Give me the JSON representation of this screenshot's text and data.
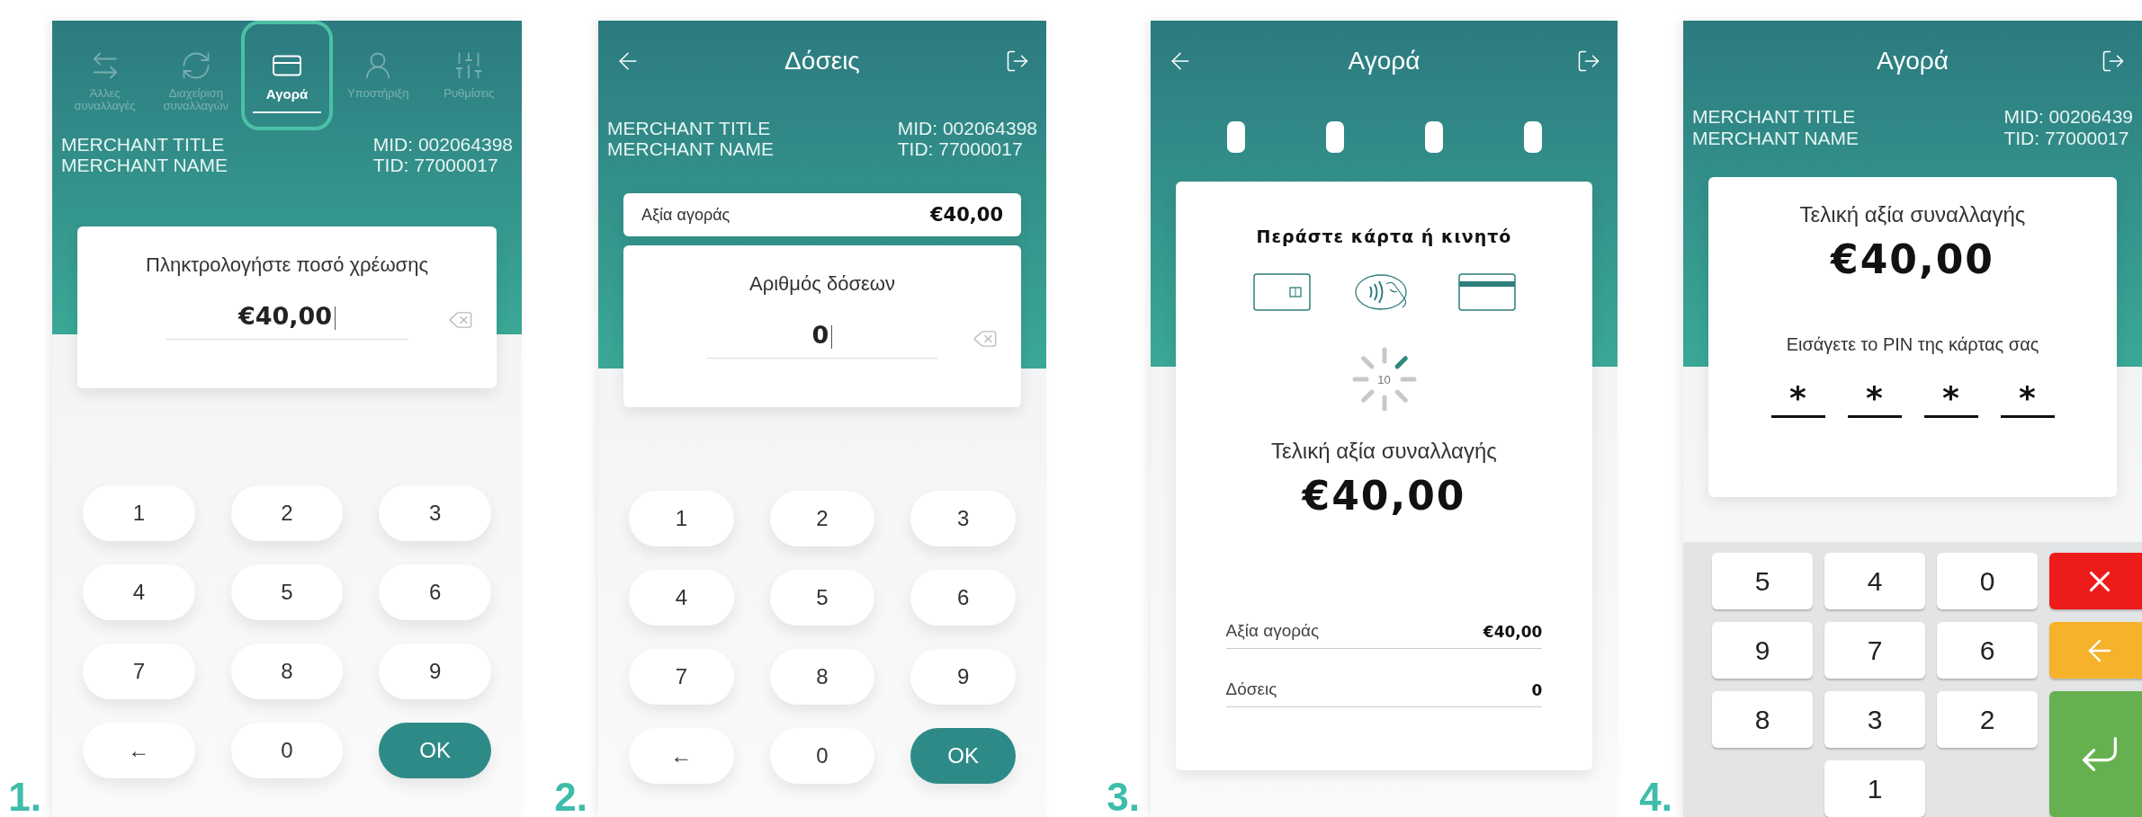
{
  "screens": [
    {
      "kind": "amount_entry",
      "step": "1.",
      "tabs": [
        {
          "label": "Άλλες συναλλαγές",
          "selected": false
        },
        {
          "label": "Διαχείριση συναλλαγών",
          "selected": false
        },
        {
          "label": "Αγορά",
          "selected": true
        },
        {
          "label": "Υποστήριξη",
          "selected": false
        },
        {
          "label": "Ρυθμίσεις",
          "selected": false
        }
      ],
      "merchant": {
        "title": "MERCHANT TITLE",
        "name": "MERCHANT NAME",
        "mid": "MID: 002064398",
        "tid": "TID: 77000017"
      },
      "prompt": "Πληκτρολογήστε ποσό χρέωσης",
      "value": "€40,00",
      "keypad": [
        {
          "label": "1",
          "kind": "digit"
        },
        {
          "label": "2",
          "kind": "digit"
        },
        {
          "label": "3",
          "kind": "digit"
        },
        {
          "label": "4",
          "kind": "digit"
        },
        {
          "label": "5",
          "kind": "digit"
        },
        {
          "label": "6",
          "kind": "digit"
        },
        {
          "label": "7",
          "kind": "digit"
        },
        {
          "label": "8",
          "kind": "digit"
        },
        {
          "label": "9",
          "kind": "digit"
        },
        {
          "label": "←",
          "kind": "back"
        },
        {
          "label": "0",
          "kind": "digit"
        },
        {
          "label": "OK",
          "kind": "ok"
        }
      ]
    },
    {
      "kind": "installments",
      "step": "2.",
      "title": "Δόσεις",
      "back_button": true,
      "merchant": {
        "title": "MERCHANT TITLE",
        "name": "MERCHANT NAME",
        "mid": "MID: 002064398",
        "tid": "TID: 77000017"
      },
      "summary": {
        "label": "Αξία αγοράς",
        "value": "€40,00"
      },
      "prompt": "Αριθμός δόσεων",
      "value": "0",
      "keypad": [
        {
          "label": "1",
          "kind": "digit"
        },
        {
          "label": "2",
          "kind": "digit"
        },
        {
          "label": "3",
          "kind": "digit"
        },
        {
          "label": "4",
          "kind": "digit"
        },
        {
          "label": "5",
          "kind": "digit"
        },
        {
          "label": "6",
          "kind": "digit"
        },
        {
          "label": "7",
          "kind": "digit"
        },
        {
          "label": "8",
          "kind": "digit"
        },
        {
          "label": "9",
          "kind": "digit"
        },
        {
          "label": "←",
          "kind": "back"
        },
        {
          "label": "0",
          "kind": "digit"
        },
        {
          "label": "OK",
          "kind": "ok"
        }
      ]
    },
    {
      "kind": "card_wait",
      "step": "3.",
      "title": "Αγορά",
      "back_button": true,
      "instruction": "Περάστε κάρτα ή κινητό",
      "countdown": "10",
      "total_label": "Τελική αξία συναλλαγής",
      "total": "€40,00",
      "details": [
        {
          "label": "Αξία αγοράς",
          "value": "€40,00"
        },
        {
          "label": "Δόσεις",
          "value": "0"
        }
      ]
    },
    {
      "kind": "pin_entry",
      "step": "4.",
      "title": "Αγορά",
      "back_button": false,
      "merchant": {
        "title": "MERCHANT TITLE",
        "name": "MERCHANT NAME",
        "mid": "MID: 00206439",
        "tid": "TID: 77000017"
      },
      "total_label": "Τελική αξία συναλλαγής",
      "total": "€40,00",
      "pin_prompt": "Εισάγετε το PIN της κάρτας σας",
      "pin_digits": [
        "*",
        "*",
        "*",
        "*"
      ],
      "pinpad": [
        {
          "label": "5",
          "kind": "digit"
        },
        {
          "label": "4",
          "kind": "digit"
        },
        {
          "label": "0",
          "kind": "digit"
        },
        {
          "kind": "cancel"
        },
        {
          "label": "9",
          "kind": "digit"
        },
        {
          "label": "7",
          "kind": "digit"
        },
        {
          "label": "6",
          "kind": "digit"
        },
        {
          "kind": "clear"
        },
        {
          "label": "8",
          "kind": "digit"
        },
        {
          "label": "3",
          "kind": "digit"
        },
        {
          "label": "2",
          "kind": "digit"
        },
        {
          "kind": "enter"
        },
        {
          "kind": "blank"
        },
        {
          "label": "1",
          "kind": "digit"
        },
        {
          "kind": "blank"
        }
      ]
    }
  ]
}
